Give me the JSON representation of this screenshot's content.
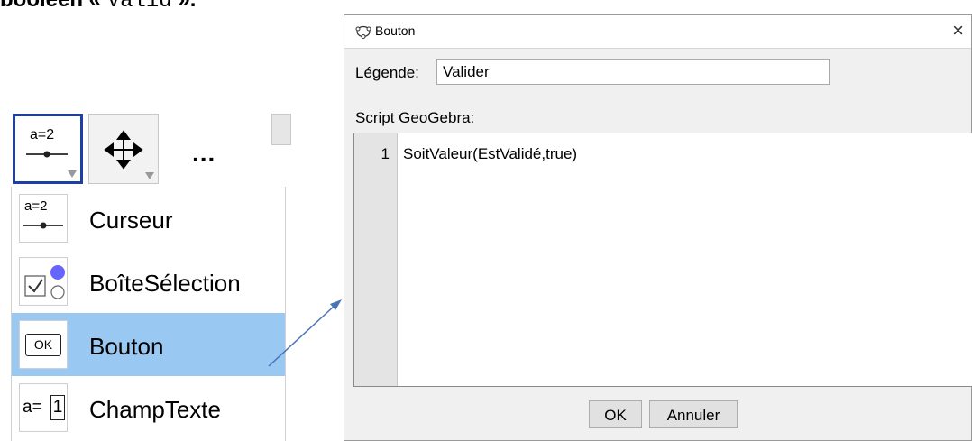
{
  "top_text": {
    "prefix": "booléen « ",
    "mono": "Valid",
    "suffix": " »."
  },
  "toolbar": {
    "slider_icon_text": "a=2",
    "more_label": "..."
  },
  "menu": {
    "items": [
      {
        "label": "Curseur",
        "icon": "slider-icon",
        "icon_text": "a=2"
      },
      {
        "label": "BoîteSélection",
        "icon": "checkbox-icon"
      },
      {
        "label": "Bouton",
        "icon": "button-icon",
        "icon_text": "OK",
        "highlighted": true
      },
      {
        "label": "ChampTexte",
        "icon": "input-box-icon",
        "icon_text_a": "a=",
        "icon_text_b": "1"
      }
    ]
  },
  "dialog": {
    "title": "Bouton",
    "close": "×",
    "caption_label": "Légende:",
    "caption_value": "Valider",
    "script_label": "Script GeoGebra:",
    "script_lines": [
      {
        "number": "1",
        "code": "SoitValeur(EstValidé,true)"
      }
    ],
    "ok_label": "OK",
    "cancel_label": "Annuler"
  },
  "colors": {
    "highlight": "#99c9f2",
    "selected_border": "#1f3fa3",
    "checkbox_dot": "#6666ff",
    "arrow": "#4a73b8"
  }
}
